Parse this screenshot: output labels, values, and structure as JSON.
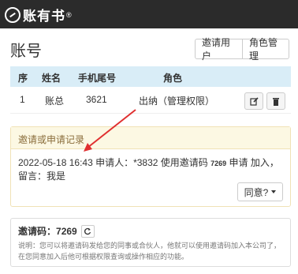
{
  "header": {
    "brand": "账有书",
    "reg_mark": "®"
  },
  "page": {
    "title": "账号"
  },
  "actions": {
    "invite_label": "邀请用户",
    "roles_label": "角色管理"
  },
  "table": {
    "headers": [
      "序",
      "姓名",
      "手机尾号",
      "角色"
    ],
    "rows": [
      {
        "index": "1",
        "name": "账总",
        "phone_tail": "3621",
        "role": "出纳（管理权限）"
      }
    ]
  },
  "requests": {
    "title": "邀请或申请记录",
    "entry_date": "2022-05-18 16:43",
    "entry_prefix": " 申请人：*3832 使用邀请码 ",
    "entry_code": "7269",
    "entry_suffix": " 申请 加入， 留言：我是",
    "agree_label": "同意?"
  },
  "invite_code": {
    "label": "邀请码：",
    "value": "7269",
    "note": "说明：您可以将邀请码发给您的同事或合伙人，他就可以使用邀请码加入本公司了，在您同意加入后他可根据权限查询或操作相应的功能。"
  },
  "colors": {
    "topbar": "#2b2b2b",
    "table_head": "#d9edf7",
    "panel_head": "#fcf8e3",
    "annotation": "#e03030"
  }
}
